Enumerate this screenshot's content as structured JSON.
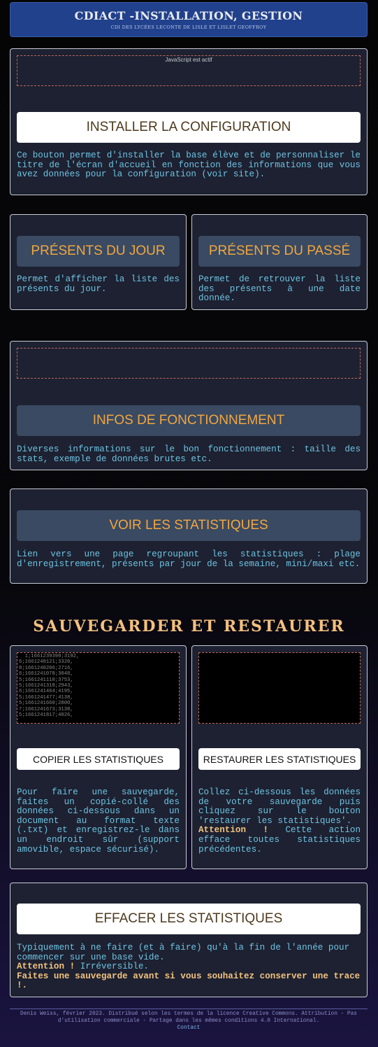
{
  "header": {
    "title": "CDIACT -INSTALLATION, GESTION",
    "subtitle": "CDI DES LYCÉES LECONTE DE LISLE ET LISLET GEOFFROY"
  },
  "install": {
    "js_note": "JavaScript est actif",
    "button": "INSTALLER LA CONFIGURATION",
    "description": "Ce bouton permet d'installer la base élève et de personnaliser le titre de l'écran d'accueil en fonction des informations que vous avez données pour la configuration (voir site)."
  },
  "presents_jour": {
    "button": "PRÉSENTS DU JOUR",
    "description": "Permet d'afficher la liste des présents du jour."
  },
  "presents_passe": {
    "button": "PRÉSENTS DU PASSÉ",
    "description": "Permet de retrouver la liste des présents à une date donnée."
  },
  "infos": {
    "button": "INFOS DE FONCTIONNEMENT",
    "description": "Diverses informations sur le bon fonctionnement : taille des stats, exemple de données brutes etc."
  },
  "stats": {
    "button": "VOIR LES STATISTIQUES",
    "description": "Lien vers une page regroupant les statistiques : plage d'enregistrement, présents par jour de la semaine, mini/maxi etc."
  },
  "backup_section_title": "SAUVEGARDER ET RESTAURER",
  "copy": {
    "data_lines": [
      "  1;1661239390;3192,",
      "6;1661240121;3320,",
      "8;1661240206;2716,",
      "6;1661241078;3048,",
      "5;1661241110;3753,",
      "5;1661241318;2943,",
      "6;1661241464;4195,",
      "5;1661241477;4138,",
      "5;1661241660;2800,",
      "7;1661241673;3138,",
      "5;1661241817;4026,"
    ],
    "button": "COPIER LES STATISTIQUES",
    "description": "Pour faire une sauvegarde, faites un copié-collé des données ci-dessous dans un document au format texte (.txt) et enregistrez-le dans un endroit sûr (support amovible, espace sécurisé)."
  },
  "restore": {
    "button": "RESTAURER LES STATISTIQUES",
    "description": "Collez ci-dessous les données de votre sauvegarde puis cliquez sur le bouton 'restaurer les statistiques'.",
    "warning_label": "Attention !",
    "warning_text": " Cette action efface toutes statistiques précédentes."
  },
  "erase": {
    "button": "EFFACER LES STATISTIQUES",
    "description": "Typiquement à ne faire (et à faire) qu'à la fin de l'année pour commencer sur une base vide.",
    "warning_label": "Attention !",
    "warning_text": " Irréversible.",
    "advice": "Faites une sauvegarde avant si vous souhaitez conserver une trace !."
  },
  "footer": {
    "text": "Denis Weiss, février 2023. Distribué selon les termes de la licence Creative Commons. Attribution - Pas d'utilisation commerciale - Partage dans les mêmes conditions 4.0 International.",
    "contact": "Contact"
  }
}
